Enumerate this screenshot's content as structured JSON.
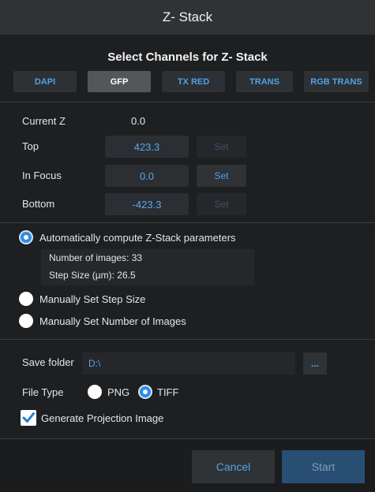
{
  "window": {
    "title": "Z- Stack"
  },
  "channels": {
    "heading": "Select Channels for Z- Stack",
    "items": [
      "DAPI",
      "GFP",
      "TX RED",
      "TRANS",
      "RGB TRANS"
    ],
    "selected": "GFP"
  },
  "positions": {
    "current_label": "Current Z",
    "current_value": "0.0",
    "top_label": "Top",
    "top_value": "423.3",
    "focus_label": "In Focus",
    "focus_value": "0.0",
    "bottom_label": "Bottom",
    "bottom_value": "-423.3",
    "set_label": "Set"
  },
  "mode": {
    "auto_label": "Automatically compute Z-Stack parameters",
    "num_images_label": "Number of images:",
    "num_images_value": "33",
    "step_size_label": "Step Size (µm):",
    "step_size_value": "26.5",
    "manual_step_label": "Manually Set Step Size",
    "manual_number_label": "Manually Set Number of Images",
    "selected": "auto"
  },
  "output": {
    "save_folder_label": "Save folder",
    "save_folder_value": "D:\\",
    "browse_label": "...",
    "file_type_label": "File Type",
    "png_label": "PNG",
    "tiff_label": "TIFF",
    "file_type_selected": "TIFF",
    "projection_label": "Generate Projection Image",
    "projection_checked": true
  },
  "footer": {
    "cancel_label": "Cancel",
    "start_label": "Start"
  },
  "colors": {
    "accent": "#4ea3e6",
    "background": "#1d1f21",
    "title_bar": "#303234"
  }
}
